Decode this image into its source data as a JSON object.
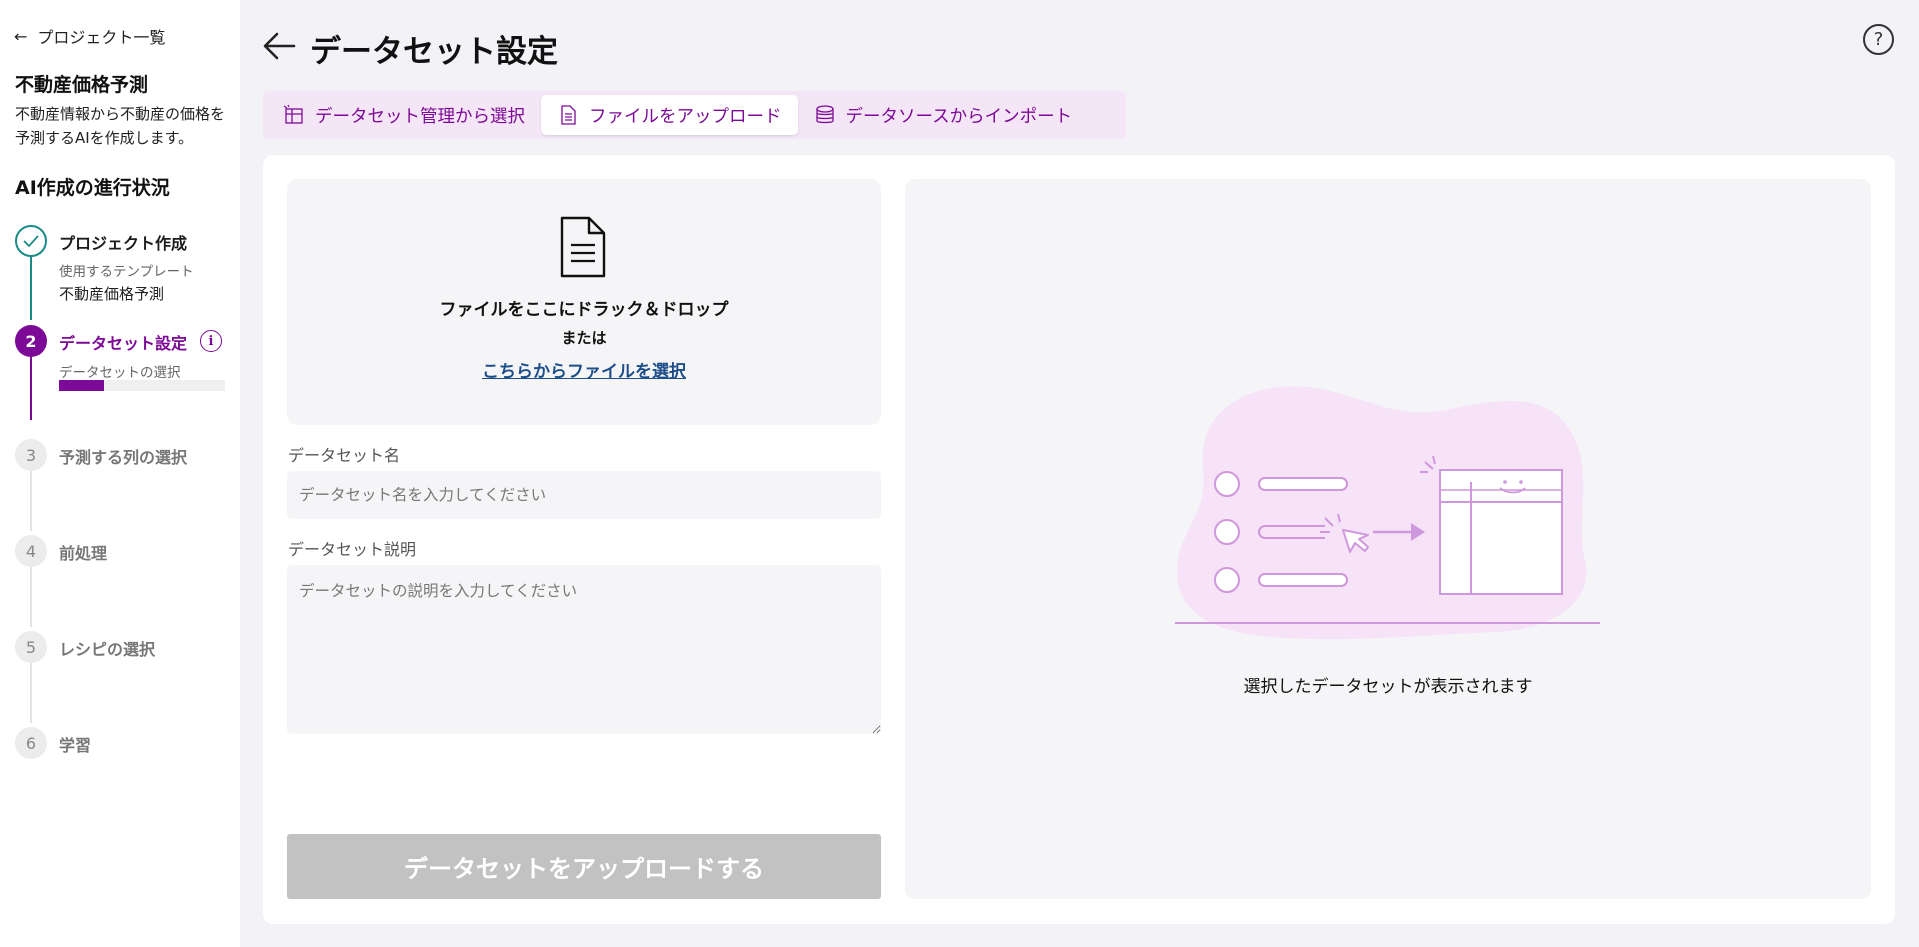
{
  "sidebar": {
    "back_label": "プロジェクト一覧",
    "project_title": "不動産価格予測",
    "project_desc": "不動産情報から不動産の価格を予測するAIを作成します。",
    "progress_title": "AI作成の進行状況",
    "steps": [
      {
        "number": "",
        "label": "プロジェクト作成",
        "sub_label": "使用するテンプレート",
        "sub_value": "不動産価格予測",
        "state": "done"
      },
      {
        "number": "2",
        "label": "データセット設定",
        "sub_label": "データセットの選択",
        "state": "active",
        "progress": 0.27
      },
      {
        "number": "3",
        "label": "予測する列の選択",
        "state": "todo"
      },
      {
        "number": "4",
        "label": "前処理",
        "state": "todo"
      },
      {
        "number": "5",
        "label": "レシピの選択",
        "state": "todo"
      },
      {
        "number": "6",
        "label": "学習",
        "state": "todo"
      }
    ]
  },
  "header": {
    "title": "データセット設定",
    "help_icon": "question-circle-icon"
  },
  "tabs": [
    {
      "label": "データセット管理から選択",
      "icon": "dataset-table-icon",
      "selected": false
    },
    {
      "label": "ファイルをアップロード",
      "icon": "document-icon",
      "selected": true
    },
    {
      "label": "データソースからインポート",
      "icon": "database-icon",
      "selected": false
    }
  ],
  "dropzone": {
    "main_text": "ファイルをここにドラック＆ドロップ",
    "or_text": "または",
    "link_text": "こちらからファイルを選択"
  },
  "form": {
    "name_label": "データセット名",
    "name_placeholder": "データセット名を入力してください",
    "desc_label": "データセット説明",
    "desc_placeholder": "データセットの説明を入力してください",
    "submit_label": "データセットをアップロードする"
  },
  "preview": {
    "empty_text": "選択したデータセットが表示されます"
  },
  "colors": {
    "accent": "#7d0a96",
    "done": "#1a8a87",
    "tab_bg": "#f5e6f7",
    "link": "#1d4e89",
    "disabled_button": "#c2c2c2"
  }
}
